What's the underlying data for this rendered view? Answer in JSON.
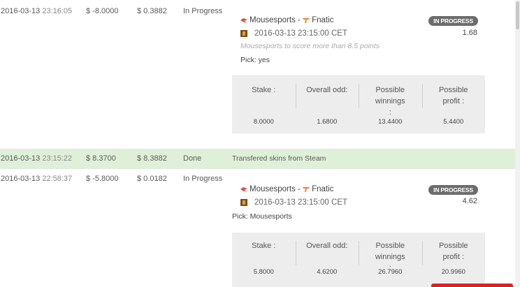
{
  "rows": [
    {
      "date": "2016-03-13",
      "time": "23:16:05",
      "amount": "$ -8.0000",
      "balance": "$ 0.3882",
      "status": "In Progress",
      "bet": {
        "team1": "Mousesports",
        "separator": " - ",
        "team2": "Fnatic",
        "event_time": "2016-03-13 23:15:00 CET",
        "market": "Mousesports to score more than 8.5 points",
        "pick": "Pick: yes",
        "badge": "IN PROGRESS",
        "odd": "1.68",
        "stats": {
          "stake_label": "Stake :",
          "stake": "8.0000",
          "odd_label": "Overall odd:",
          "odd": "1.6800",
          "winnings_label": "Possible winnings :",
          "winnings": "13.4400",
          "profit_label": "Possible profit :",
          "profit": "5.4400"
        }
      }
    },
    {
      "date": "2016-03-13",
      "time": "23:15:22",
      "amount": "$ 8.3700",
      "balance": "$ 8.3882",
      "status": "Done",
      "description": "Transfered skins from Steam"
    },
    {
      "date": "2016-03-13",
      "time": "22:58:37",
      "amount": "$ -5.8000",
      "balance": "$ 0.0182",
      "status": "In Progress",
      "bet": {
        "team1": "Mousesports",
        "separator": " - ",
        "team2": "Fnatic",
        "event_time": "2016-03-13 23:15:00 CET",
        "pick": "Pick: Mousesports",
        "badge": "IN PROGRESS",
        "odd": "4.62",
        "stats": {
          "stake_label": "Stake :",
          "stake": "5.8000",
          "odd_label": "Overall odd:",
          "odd": "4.6200",
          "winnings_label": "Possible winnings :",
          "winnings": "26.7960",
          "profit_label": "Possible profit :",
          "profit": "20.9960"
        }
      }
    }
  ],
  "colors": {
    "done_row_bg": "#dff0d8",
    "badge_bg": "#6c6c6c",
    "stats_bg": "#ededed",
    "team1_icon": "#d9534f",
    "team2_icon": "#f0833a"
  },
  "icons": {
    "team1": "mousesports-logo-icon",
    "team2": "fnatic-logo-icon",
    "game": "csgo-game-icon"
  }
}
